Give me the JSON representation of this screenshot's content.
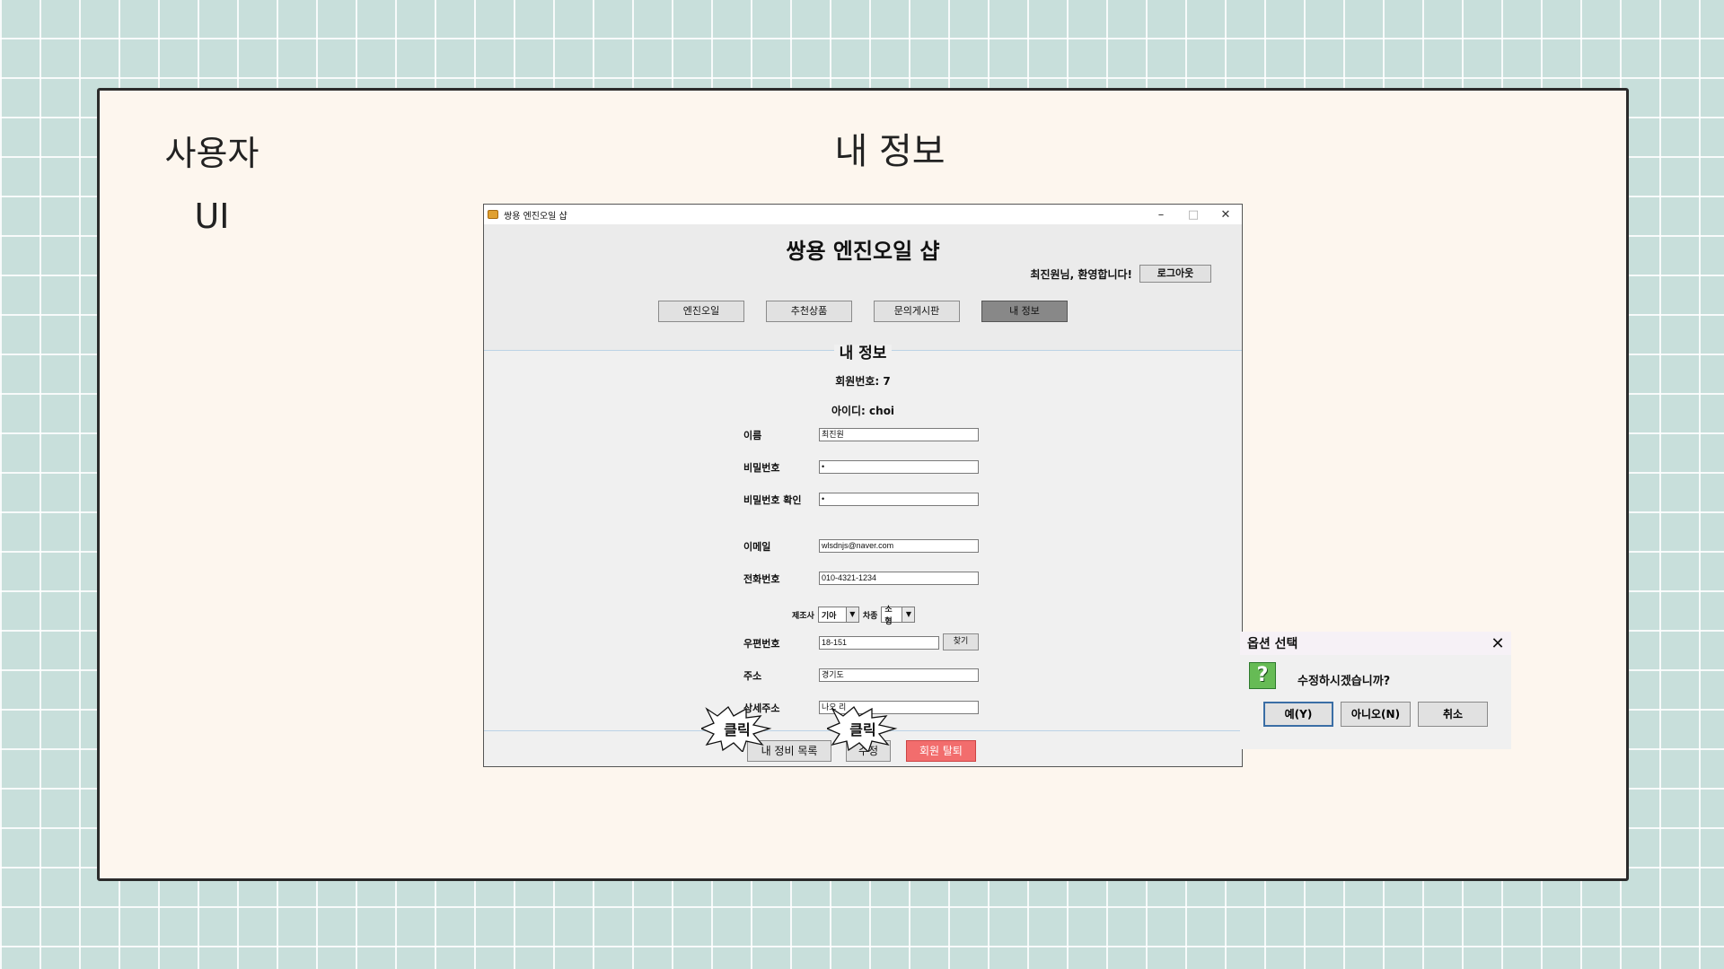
{
  "slide": {
    "side_label_1": "사용자",
    "side_label_2": "UI",
    "title": "내 정보"
  },
  "window": {
    "title": "쌍용 엔진오일 샵",
    "app_title": "쌍용 엔진오일 샵",
    "welcome": "최진원님, 환영합니다!",
    "logout": "로그아웃",
    "nav": [
      "엔진오일",
      "추천상품",
      "문의게시판",
      "내 정보"
    ],
    "active_nav": "내 정보"
  },
  "profile": {
    "section_title": "내 정보",
    "member_no": "회원번호: 7",
    "user_id": "아이디: choi",
    "fields": [
      {
        "label": "이름",
        "value": "최진원"
      },
      {
        "label": "비밀번호",
        "value": "•"
      },
      {
        "label": "비밀번호 확인",
        "value": "•"
      },
      {
        "label": "이메일",
        "value": "wlsdnjs@naver.com"
      },
      {
        "label": "전화번호",
        "value": "010-4321-1234"
      },
      {
        "label": "우편번호",
        "value": "18-151"
      },
      {
        "label": "주소",
        "value": "경기도"
      },
      {
        "label": "상세주소",
        "value": "나오 리"
      }
    ],
    "maker_label": "제조사",
    "maker_value": "기아",
    "car_type_label": "차종",
    "car_type_value": "소형",
    "find_button": "찾기",
    "buttons": {
      "my_maintenance": "내 정비 목록",
      "edit": "수정",
      "withdraw": "회원 탈퇴"
    },
    "click_marker": "클릭",
    "withdraw_color": "#f26d6d"
  },
  "dialog": {
    "title": "옵션 선택",
    "message": "수정하시겠습니까?",
    "yes": "예(Y)",
    "no": "아니오(N)",
    "cancel": "취소"
  }
}
